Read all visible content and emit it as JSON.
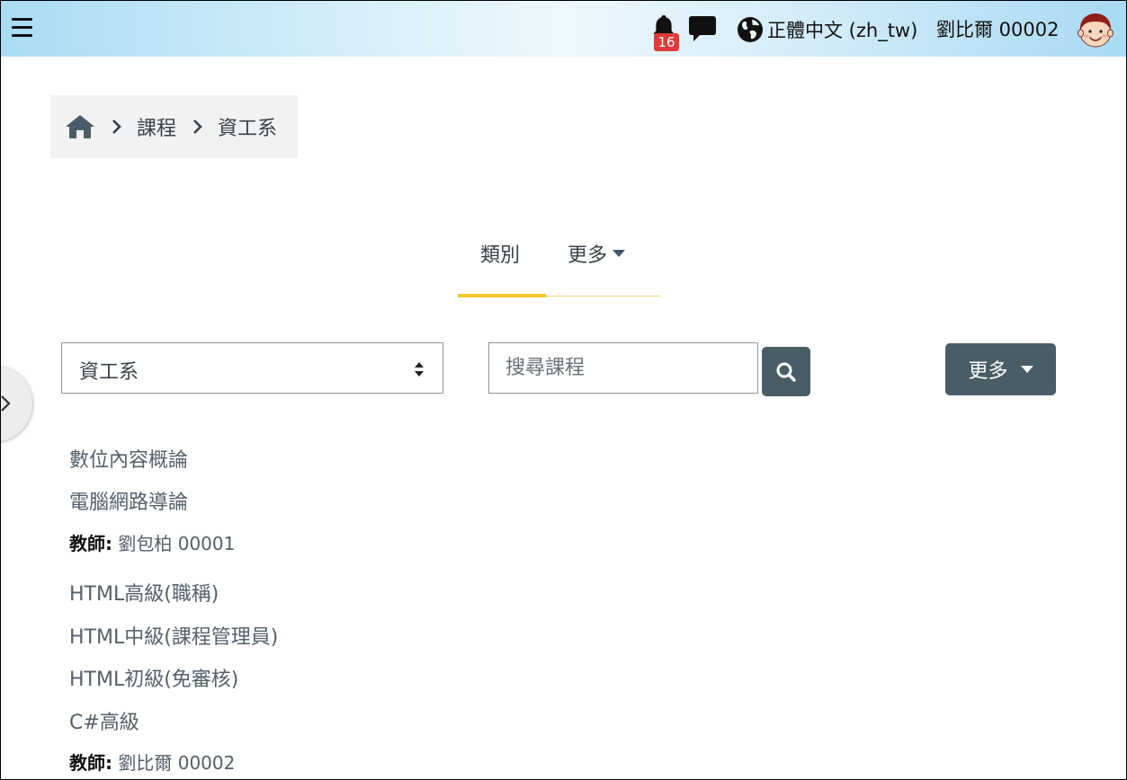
{
  "header": {
    "notification_count": "16",
    "language_label": "正體中文 (zh_tw)",
    "user_name": "劉比爾 00002"
  },
  "breadcrumb": {
    "items": [
      "課程",
      "資工系"
    ]
  },
  "tabs": {
    "category_label": "類別",
    "more_label": "更多"
  },
  "filters": {
    "category_selected": "資工系",
    "search_placeholder": "搜尋課程",
    "more_button_label": "更多"
  },
  "courses": [
    {
      "name": "數位內容概論"
    },
    {
      "name": "電腦網路導論"
    },
    {
      "teacher_label": "教師:",
      "teacher_name": "劉包柏 00001"
    },
    {
      "name": "HTML高級(職稱)"
    },
    {
      "name": "HTML中級(課程管理員)"
    },
    {
      "name": "HTML初級(免審核)"
    },
    {
      "name": "C#高級"
    },
    {
      "teacher_label": "教師:",
      "teacher_name": "劉比爾 00002"
    }
  ],
  "colors": {
    "primary_button": "#4a5d67",
    "tab_active": "#f5c630",
    "badge": "#e03a3a"
  }
}
